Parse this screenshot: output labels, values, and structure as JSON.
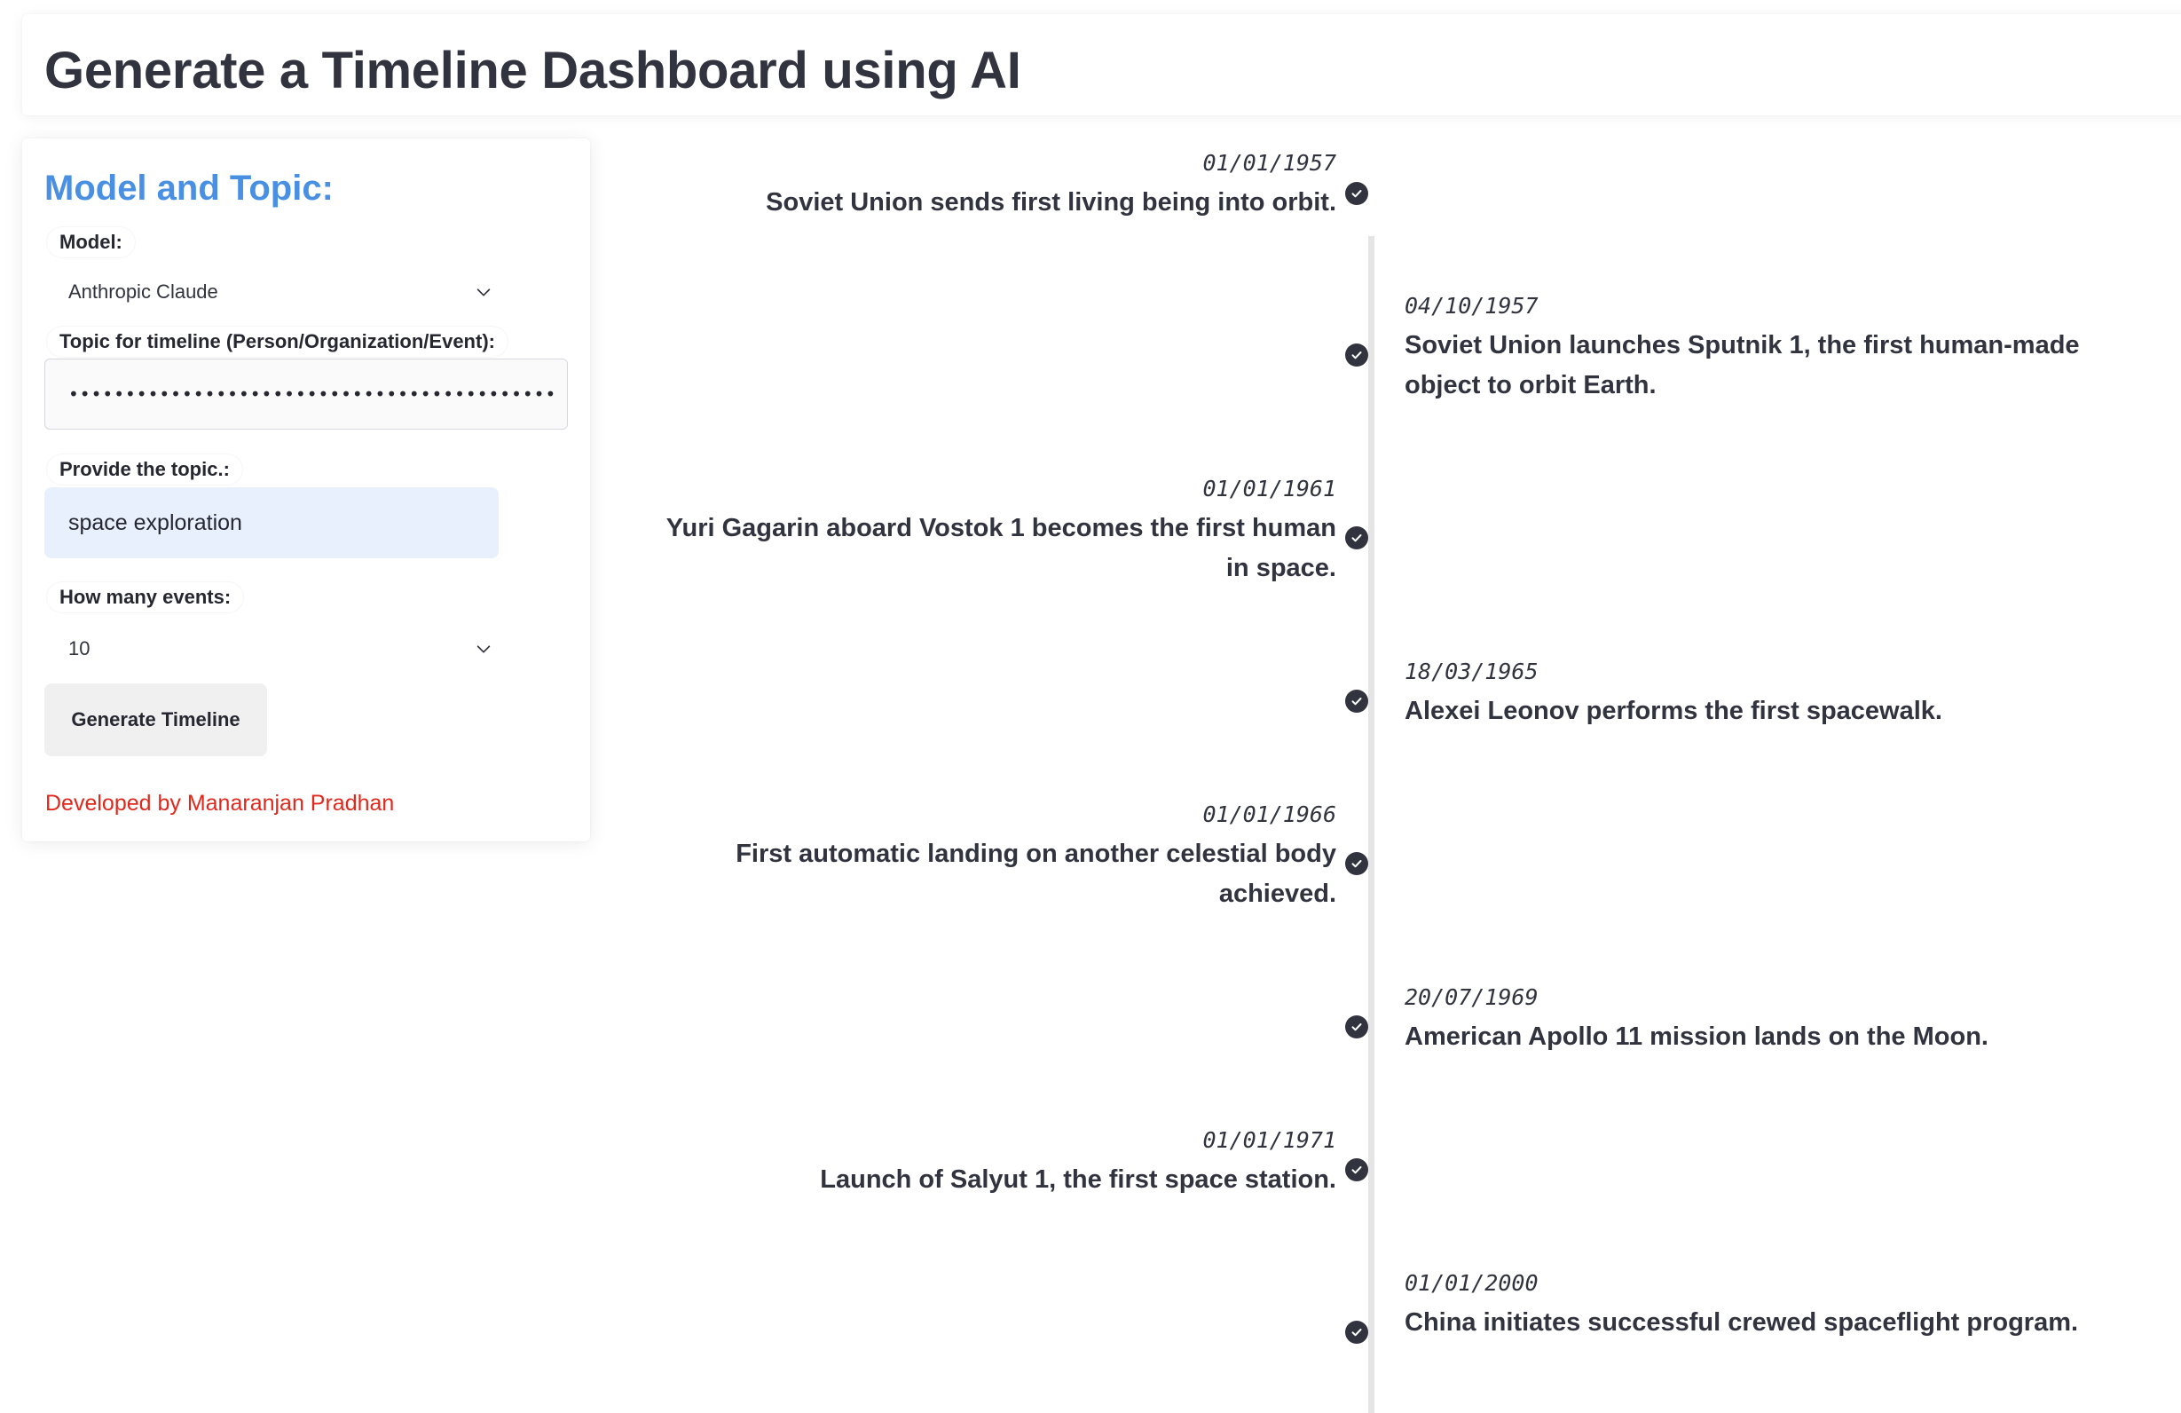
{
  "page_title": "Generate a Timeline Dashboard using AI",
  "sidebar": {
    "title": "Model and Topic:",
    "model_label": "Model:",
    "model_value": "Anthropic Claude",
    "api_label": "Topic for timeline (Person/Organization/Event):",
    "api_value": "•••••••••••••••••••••••••••••••••••••••••••",
    "topic_label": "Provide the topic.:",
    "topic_value": "space exploration",
    "events_label": "How many events:",
    "events_value": "10",
    "generate_label": "Generate Timeline",
    "credit": "Developed by Manaranjan Pradhan"
  },
  "timeline": {
    "events": [
      {
        "date": "01/01/1957",
        "text": "Soviet Union sends first living being into orbit.",
        "side": "left"
      },
      {
        "date": "04/10/1957",
        "text": "Soviet Union launches Sputnik 1, the first human-made object to orbit Earth.",
        "side": "right"
      },
      {
        "date": "01/01/1961",
        "text": "Yuri Gagarin aboard Vostok 1 becomes the first human in space.",
        "side": "left"
      },
      {
        "date": "18/03/1965",
        "text": "Alexei Leonov performs the first spacewalk.",
        "side": "right"
      },
      {
        "date": "01/01/1966",
        "text": "First automatic landing on another celestial body achieved.",
        "side": "left"
      },
      {
        "date": "20/07/1969",
        "text": "American Apollo 11 mission lands on the Moon.",
        "side": "right"
      },
      {
        "date": "01/01/1971",
        "text": "Launch of Salyut 1, the first space station.",
        "side": "left"
      },
      {
        "date": "01/01/2000",
        "text": "China initiates successful crewed spaceflight program.",
        "side": "right"
      }
    ]
  },
  "colors": {
    "accent": "#4a90e2",
    "credit": "#e0281c",
    "topic_bg": "#e8f0fe",
    "marker": "#31333f"
  },
  "icons": {
    "select_arrow": "chevron-down-icon",
    "event_marker": "check-circle-icon"
  }
}
